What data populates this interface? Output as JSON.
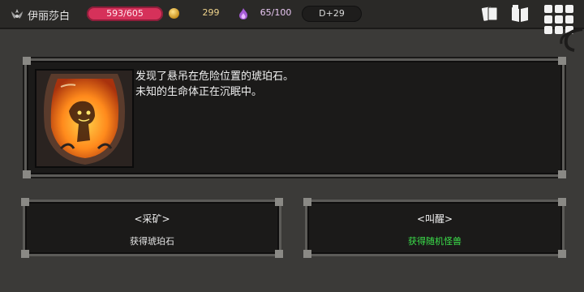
{
  "topbar": {
    "hero_icon": "crown-wings-icon",
    "hero_name": "伊丽莎白",
    "hp": "593/605",
    "gold_icon": "coin-icon",
    "gold": "299",
    "soul_icon": "purple-flame-icon",
    "souls": "65/100",
    "day": "D+29",
    "buttons": [
      "cards-icon",
      "book-icon",
      "menu-grid-icon"
    ]
  },
  "event": {
    "portrait": "amber-with-creature-image",
    "line1": "发现了悬吊在危险位置的琥珀石。",
    "line2": "未知的生命体正在沉眠中。"
  },
  "choices": [
    {
      "title": "<采矿>",
      "desc": "获得琥珀石",
      "desc_color": "#e6e6e6"
    },
    {
      "title": "<叫醒>",
      "desc": "获得随机怪兽",
      "desc_color": "#3be04b"
    }
  ],
  "colors": {
    "hp_bar": "#d6315a",
    "gold_text": "#f0d48c",
    "soul_text": "#e9c7f3",
    "reward_highlight": "#3be04b"
  }
}
